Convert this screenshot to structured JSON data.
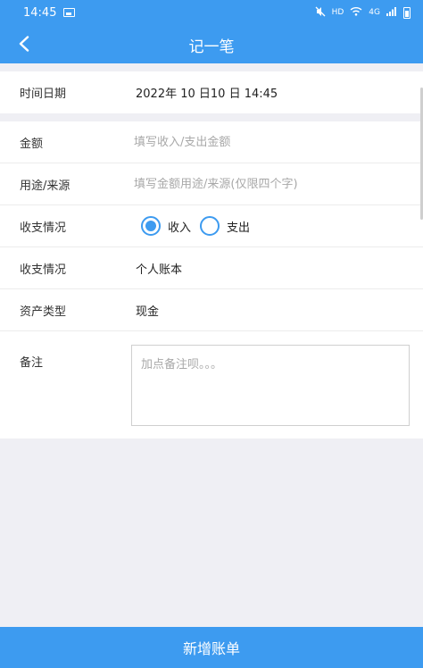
{
  "status_bar": {
    "time": "14:45",
    "network_label": "HD",
    "signal_label": "4G"
  },
  "header": {
    "title": "记一笔",
    "back_icon": "chevron-left-icon"
  },
  "form": {
    "datetime": {
      "label": "时间日期",
      "value": "2022年 10 日10 日  14:45"
    },
    "amount": {
      "label": "金额",
      "placeholder": "填写收入/支出金额",
      "value": ""
    },
    "purpose": {
      "label": "用途/来源",
      "placeholder": "填写金额用途/来源(仅限四个字)",
      "value": ""
    },
    "type": {
      "label": "收支情况",
      "options": [
        {
          "label": "收入",
          "checked": true
        },
        {
          "label": "支出",
          "checked": false
        }
      ]
    },
    "account": {
      "label": "收支情况",
      "value": "个人账本"
    },
    "asset": {
      "label": "资产类型",
      "value": "现金"
    },
    "notes": {
      "label": "备注",
      "placeholder": "加点备注呗。。。",
      "value": ""
    }
  },
  "submit_label": "新增账单",
  "colors": {
    "primary": "#3d9bf0",
    "background": "#efeff4",
    "placeholder": "#a8a8a8"
  }
}
